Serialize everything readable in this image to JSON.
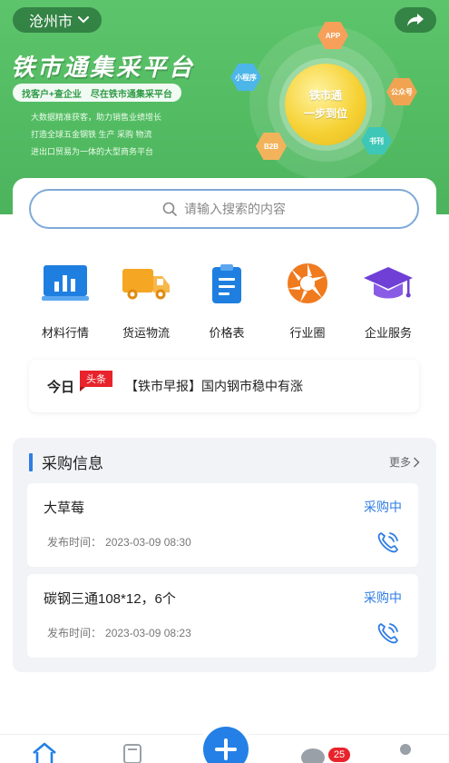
{
  "banner": {
    "city": "沧州市",
    "title": "铁市通集采平台",
    "tagline": "找客户+查企业　尽在铁市通集采平台",
    "desc_lines": [
      "大数据精准获客，助力销售业绩增长",
      "打造全球五金钢铁 生产 采购 物流",
      "进出口贸易为一体的大型商务平台"
    ],
    "core_line1": "铁市通",
    "core_line2": "一步到位",
    "orbit": {
      "app": "APP",
      "mini": "小程序",
      "gzh": "公众号",
      "b2b": "B2B",
      "kan": "书刊"
    }
  },
  "search": {
    "placeholder": "请输入搜索的内容"
  },
  "menu": [
    {
      "label": "材料行情",
      "icon": "chart-monitor-icon"
    },
    {
      "label": "货运物流",
      "icon": "truck-icon"
    },
    {
      "label": "价格表",
      "icon": "clipboard-list-icon"
    },
    {
      "label": "行业圈",
      "icon": "aperture-icon"
    },
    {
      "label": "企业服务",
      "icon": "graduation-cap-icon"
    }
  ],
  "news": {
    "today": "今日",
    "tag": "头条",
    "text": "【铁市早报】国内钢市稳中有涨"
  },
  "purchase": {
    "title": "采购信息",
    "more": "更多",
    "time_label": "发布时间：",
    "items": [
      {
        "title": "大草莓",
        "status": "采购中",
        "time": "2023-03-09 08:30"
      },
      {
        "title": "碳钢三通108*12，6个",
        "status": "采购中",
        "time": "2023-03-09 08:23"
      }
    ]
  },
  "bottom_nav": {
    "badge": "25"
  },
  "colors": {
    "brand_green": "#52bb62",
    "accent_blue": "#2e7ce4",
    "tag_red": "#e8232b"
  }
}
